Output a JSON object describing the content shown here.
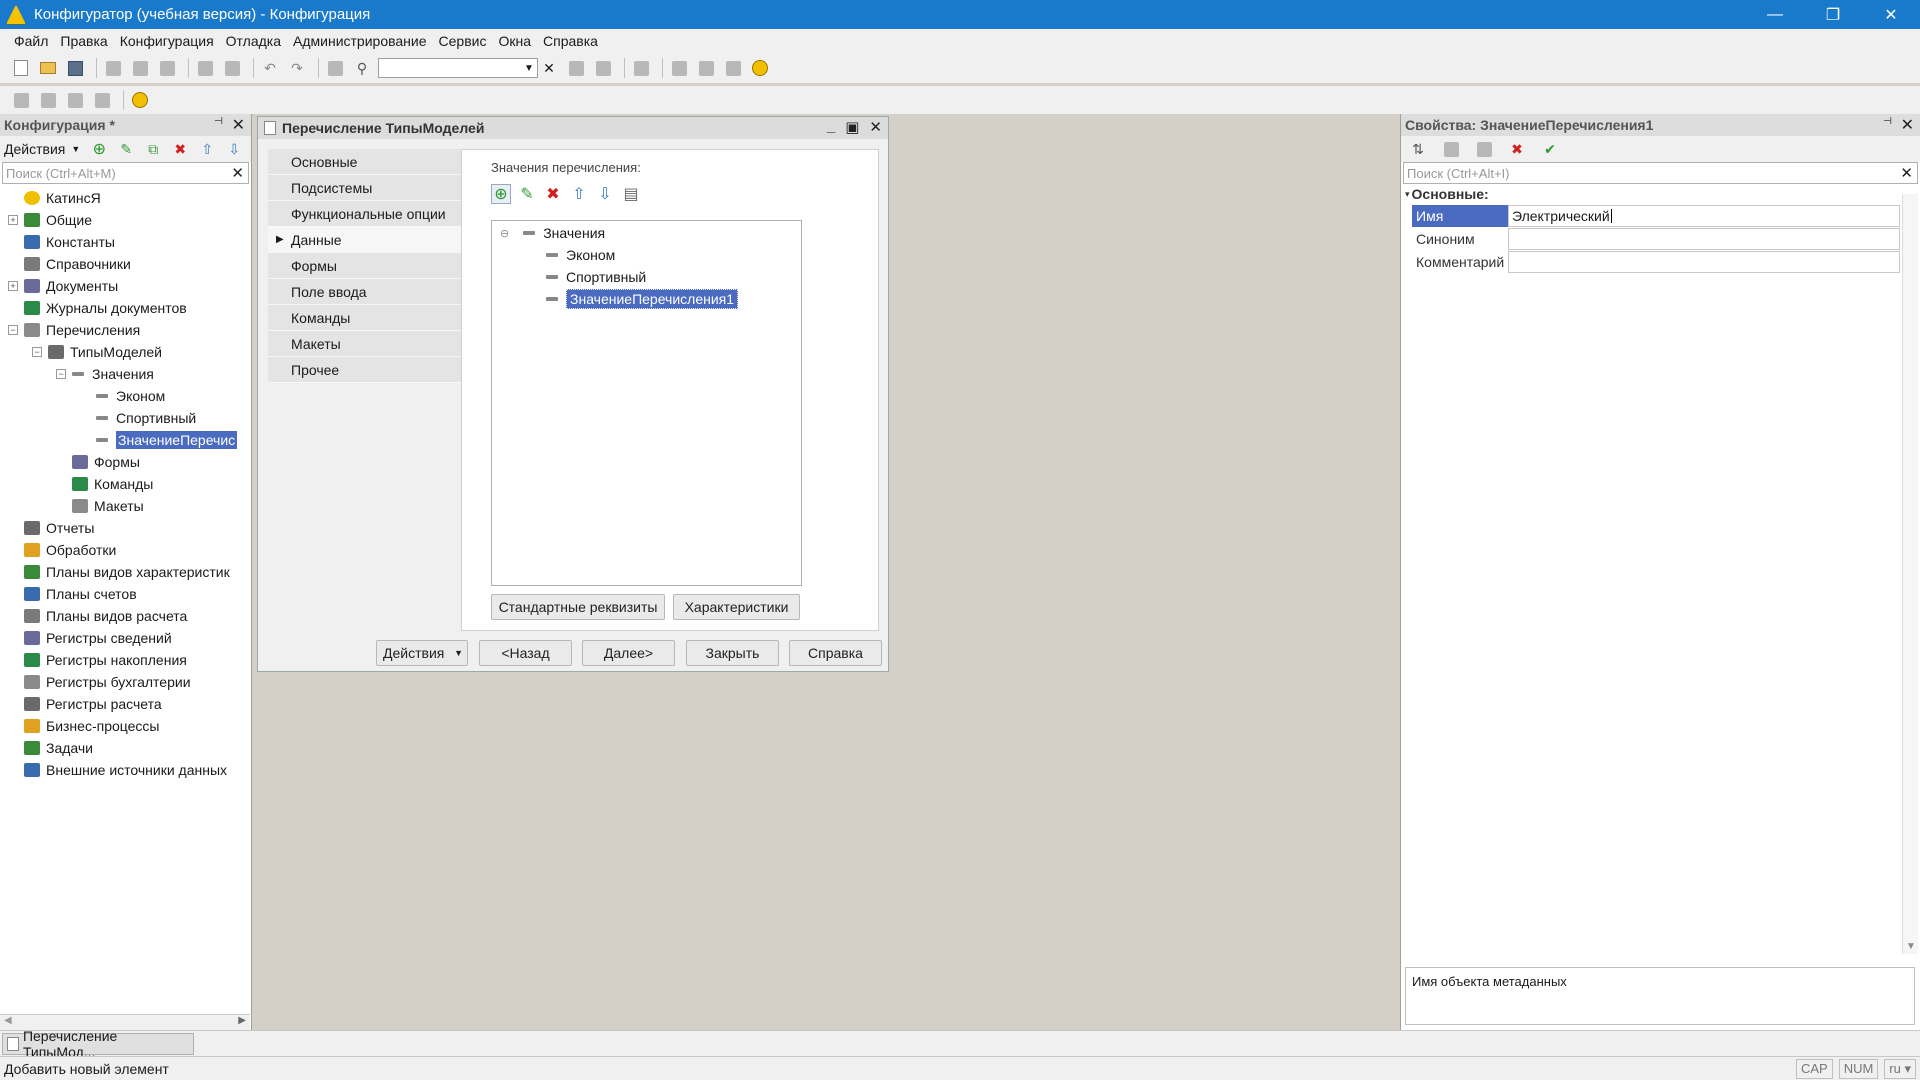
{
  "window": {
    "title": "Конфигуратор (учебная версия) - Конфигурация",
    "controls": [
      "—",
      "❐",
      "✕"
    ]
  },
  "menu": [
    "Файл",
    "Правка",
    "Конфигурация",
    "Отладка",
    "Администрирование",
    "Сервис",
    "Окна",
    "Справка"
  ],
  "left_panel": {
    "title": "Конфигурация *",
    "actions_label": "Действия",
    "search_placeholder": "Поиск (Ctrl+Alt+M)",
    "tree": [
      {
        "label": "КатинсЯ",
        "depth": 0,
        "expander": "",
        "icon": "config-icon"
      },
      {
        "label": "Общие",
        "depth": 0,
        "expander": "+",
        "icon": "common-icon"
      },
      {
        "label": "Константы",
        "depth": 0,
        "expander": "",
        "icon": "constants-icon"
      },
      {
        "label": "Справочники",
        "depth": 0,
        "expander": "",
        "icon": "catalogs-icon"
      },
      {
        "label": "Документы",
        "depth": 0,
        "expander": "+",
        "icon": "documents-icon"
      },
      {
        "label": "Журналы документов",
        "depth": 0,
        "expander": "",
        "icon": "journals-icon"
      },
      {
        "label": "Перечисления",
        "depth": 0,
        "expander": "−",
        "icon": "enums-icon"
      },
      {
        "label": "ТипыМоделей",
        "depth": 1,
        "expander": "−",
        "icon": "enum-icon"
      },
      {
        "label": "Значения",
        "depth": 2,
        "expander": "−",
        "icon": "dash"
      },
      {
        "label": "Эконом",
        "depth": 3,
        "expander": "",
        "icon": "dash"
      },
      {
        "label": "Спортивный",
        "depth": 3,
        "expander": "",
        "icon": "dash"
      },
      {
        "label": "ЗначениеПеречис",
        "depth": 3,
        "expander": "",
        "icon": "dash",
        "selected": true
      },
      {
        "label": "Формы",
        "depth": 2,
        "expander": "",
        "icon": "forms-icon"
      },
      {
        "label": "Команды",
        "depth": 2,
        "expander": "",
        "icon": "commands-icon"
      },
      {
        "label": "Макеты",
        "depth": 2,
        "expander": "",
        "icon": "templates-icon"
      },
      {
        "label": "Отчеты",
        "depth": 0,
        "expander": "",
        "icon": "reports-icon"
      },
      {
        "label": "Обработки",
        "depth": 0,
        "expander": "",
        "icon": "processing-icon"
      },
      {
        "label": "Планы видов характеристик",
        "depth": 0,
        "expander": "",
        "icon": "chart-types-icon"
      },
      {
        "label": "Планы счетов",
        "depth": 0,
        "expander": "",
        "icon": "accounts-icon"
      },
      {
        "label": "Планы видов расчета",
        "depth": 0,
        "expander": "",
        "icon": "calc-types-icon"
      },
      {
        "label": "Регистры сведений",
        "depth": 0,
        "expander": "",
        "icon": "info-registers-icon"
      },
      {
        "label": "Регистры накопления",
        "depth": 0,
        "expander": "",
        "icon": "accum-registers-icon"
      },
      {
        "label": "Регистры бухгалтерии",
        "depth": 0,
        "expander": "",
        "icon": "accounting-registers-icon"
      },
      {
        "label": "Регистры расчета",
        "depth": 0,
        "expander": "",
        "icon": "calc-registers-icon"
      },
      {
        "label": "Бизнес-процессы",
        "depth": 0,
        "expander": "",
        "icon": "business-process-icon"
      },
      {
        "label": "Задачи",
        "depth": 0,
        "expander": "",
        "icon": "tasks-icon"
      },
      {
        "label": "Внешние источники данных",
        "depth": 0,
        "expander": "",
        "icon": "external-sources-icon"
      }
    ]
  },
  "dialog": {
    "title": "Перечисление ТипыМоделей",
    "nav": [
      "Основные",
      "Подсистемы",
      "Функциональные опции",
      "Данные",
      "Формы",
      "Поле ввода",
      "Команды",
      "Макеты",
      "Прочее"
    ],
    "active_nav": "Данные",
    "values_label": "Значения перечисления:",
    "values_tree": {
      "root": "Значения",
      "items": [
        "Эконом",
        "Спортивный",
        "ЗначениеПеречисления1"
      ],
      "selected": "ЗначениеПеречисления1"
    },
    "std_attrs_button": "Стандартные реквизиты",
    "characteristics_button": "Характеристики",
    "footer": {
      "actions": "Действия",
      "back": "<Назад",
      "next": "Далее>",
      "close": "Закрыть",
      "help": "Справка"
    }
  },
  "properties": {
    "title": "Свойства: ЗначениеПеречисления1",
    "search_placeholder": "Поиск (Ctrl+Alt+I)",
    "section": "Основные:",
    "rows": [
      {
        "name": "Имя",
        "value": "Электрический"
      },
      {
        "name": "Синоним",
        "value": ""
      },
      {
        "name": "Комментарий",
        "value": ""
      }
    ],
    "description": "Имя объекта метаданных"
  },
  "taskbar": {
    "item": "Перечисление ТипыМод..."
  },
  "statusbar": {
    "message": "Добавить новый элемент",
    "indicators": [
      "CAP",
      "NUM",
      "ru ▾"
    ]
  },
  "colors": {
    "titlebar": "#1979ca",
    "selection": "#4a6bc0",
    "workspace": "#d4d0c8"
  }
}
